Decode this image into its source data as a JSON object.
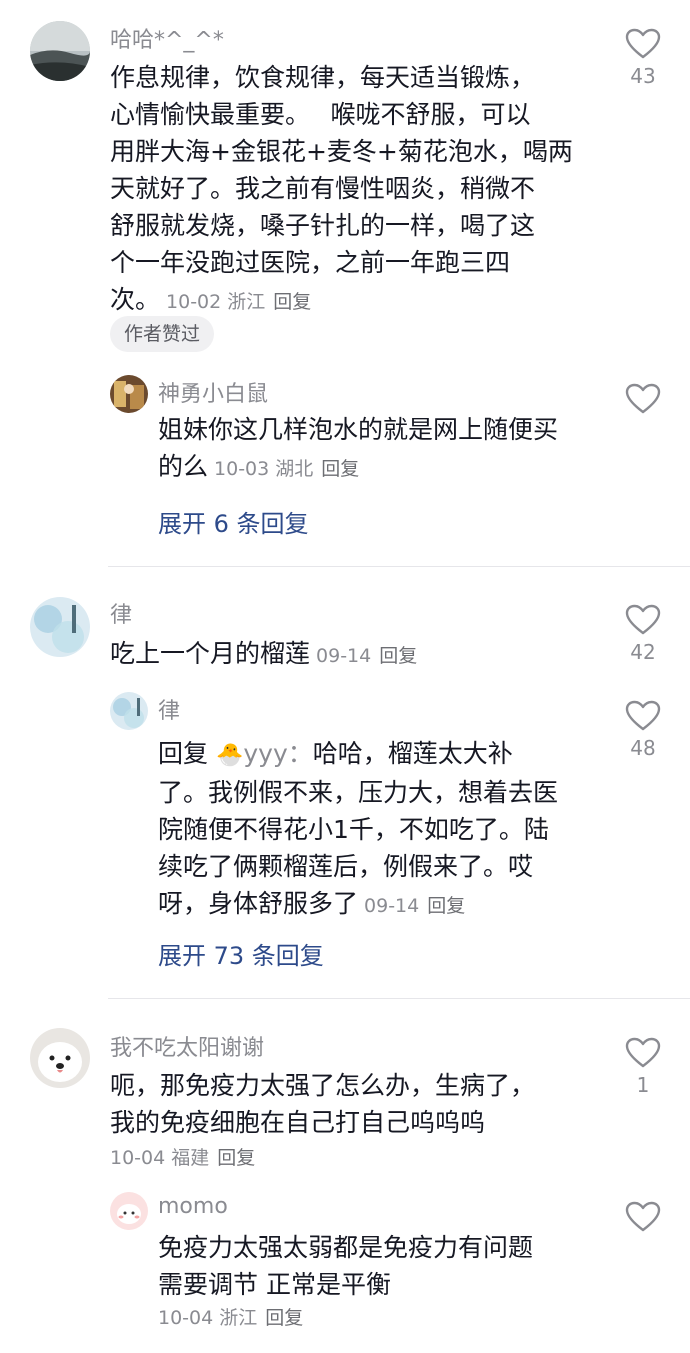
{
  "comments": [
    {
      "username": "哈哈*^_^*",
      "text_lines": [
        "作息规律，饮食规律，每天适当锻炼，",
        "心情愉快最重要。　 喉咙不舒服，可以",
        "用胖大海+金银花+麦冬+菊花泡水，喝两",
        "天就好了。我之前有慢性咽炎，稍微不",
        "舒服就发烧，嗓子针扎的一样，喝了这",
        "个一年没跑过医院，之前一年跑三四",
        "次。"
      ],
      "date": "10-02",
      "location": "浙江",
      "reply_label": "回复",
      "likes": "43",
      "badge": "作者赞过",
      "reply": {
        "username": "神勇小白鼠",
        "text_lines": [
          "姐妹你这几样泡水的就是网上随便买",
          "的么"
        ],
        "date": "10-03",
        "location": "湖北",
        "reply_label": "回复"
      },
      "expand_label": "展开 6 条回复"
    },
    {
      "username": "律",
      "text_lines": [
        "吃上一个月的榴莲"
      ],
      "date": "09-14",
      "reply_label": "回复",
      "likes": "42",
      "reply": {
        "username": "律",
        "text_prefix": "回复",
        "mention_emoji": "🐣",
        "mention_name": "yyy：",
        "text_lines": [
          "哈哈，榴莲太大补",
          "了。我例假不来，压力大，想着去医",
          "院随便不得花小1千，不如吃了。陆",
          "续吃了俩颗榴莲后，例假来了。哎",
          "呀，身体舒服多了"
        ],
        "date": "09-14",
        "reply_label": "回复",
        "likes": "48"
      },
      "expand_label": "展开 73 条回复"
    },
    {
      "username": "我不吃太阳谢谢",
      "text_lines": [
        "呃，那免疫力太强了怎么办，生病了，",
        "我的免疫细胞在自己打自己呜呜呜"
      ],
      "date": "10-04",
      "location": "福建",
      "reply_label": "回复",
      "likes": "1",
      "reply": {
        "username": "momo",
        "text_lines": [
          "免疫力太强太弱都是免疫力有问题",
          "需要调节 正常是平衡"
        ],
        "date": "10-04",
        "location": "浙江",
        "reply_label": "回复"
      }
    }
  ],
  "icons": {
    "like": "heart-outline-icon"
  },
  "colors": {
    "expand_link": "#2d4a8a",
    "meta": "#8a8b91"
  }
}
